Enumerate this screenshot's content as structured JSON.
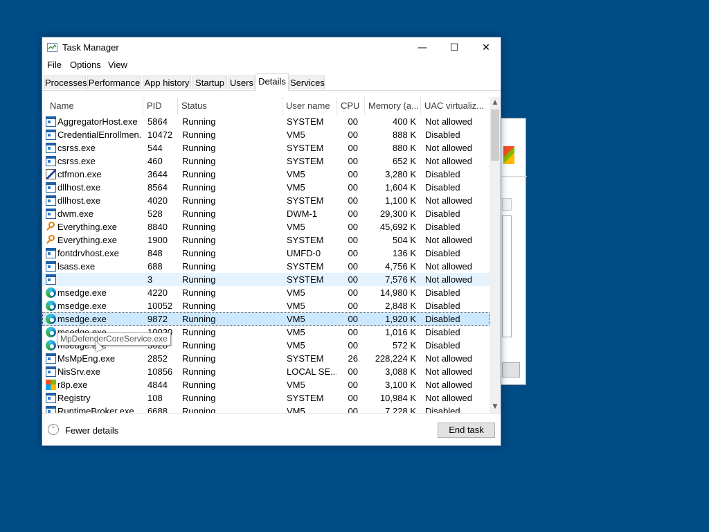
{
  "window": {
    "title": "Task Manager",
    "icon": "task-manager-icon",
    "controls": {
      "minimize": "—",
      "maximize": "☐",
      "close": "✕"
    }
  },
  "menu": [
    "File",
    "Options",
    "View"
  ],
  "tabs": [
    {
      "label": "Processes",
      "active": false
    },
    {
      "label": "Performance",
      "active": false
    },
    {
      "label": "App history",
      "active": false
    },
    {
      "label": "Startup",
      "active": false
    },
    {
      "label": "Users",
      "active": false
    },
    {
      "label": "Details",
      "active": true
    },
    {
      "label": "Services",
      "active": false
    }
  ],
  "columns": [
    "Name",
    "PID",
    "Status",
    "User name",
    "CPU",
    "Memory (a...",
    "UAC virtualiz..."
  ],
  "rows": [
    {
      "icon": "exe",
      "name": "AggregatorHost.exe",
      "pid": "5864",
      "status": "Running",
      "user": "SYSTEM",
      "cpu": "00",
      "mem": "400 K",
      "uac": "Not allowed"
    },
    {
      "icon": "exe",
      "name": "CredentialEnrollmen...",
      "pid": "10472",
      "status": "Running",
      "user": "VM5",
      "cpu": "00",
      "mem": "888 K",
      "uac": "Disabled"
    },
    {
      "icon": "exe",
      "name": "csrss.exe",
      "pid": "544",
      "status": "Running",
      "user": "SYSTEM",
      "cpu": "00",
      "mem": "880 K",
      "uac": "Not allowed"
    },
    {
      "icon": "exe",
      "name": "csrss.exe",
      "pid": "460",
      "status": "Running",
      "user": "SYSTEM",
      "cpu": "00",
      "mem": "652 K",
      "uac": "Not allowed"
    },
    {
      "icon": "pen",
      "name": "ctfmon.exe",
      "pid": "3644",
      "status": "Running",
      "user": "VM5",
      "cpu": "00",
      "mem": "3,280 K",
      "uac": "Disabled"
    },
    {
      "icon": "exe",
      "name": "dllhost.exe",
      "pid": "8564",
      "status": "Running",
      "user": "VM5",
      "cpu": "00",
      "mem": "1,604 K",
      "uac": "Disabled"
    },
    {
      "icon": "exe",
      "name": "dllhost.exe",
      "pid": "4020",
      "status": "Running",
      "user": "SYSTEM",
      "cpu": "00",
      "mem": "1,100 K",
      "uac": "Not allowed"
    },
    {
      "icon": "exe",
      "name": "dwm.exe",
      "pid": "528",
      "status": "Running",
      "user": "DWM-1",
      "cpu": "00",
      "mem": "29,300 K",
      "uac": "Disabled"
    },
    {
      "icon": "search",
      "name": "Everything.exe",
      "pid": "8840",
      "status": "Running",
      "user": "VM5",
      "cpu": "00",
      "mem": "45,692 K",
      "uac": "Disabled"
    },
    {
      "icon": "search",
      "name": "Everything.exe",
      "pid": "1900",
      "status": "Running",
      "user": "SYSTEM",
      "cpu": "00",
      "mem": "504 K",
      "uac": "Not allowed"
    },
    {
      "icon": "exe",
      "name": "fontdrvhost.exe",
      "pid": "848",
      "status": "Running",
      "user": "UMFD-0",
      "cpu": "00",
      "mem": "136 K",
      "uac": "Disabled"
    },
    {
      "icon": "exe",
      "name": "lsass.exe",
      "pid": "688",
      "status": "Running",
      "user": "SYSTEM",
      "cpu": "00",
      "mem": "4,756 K",
      "uac": "Not allowed"
    },
    {
      "icon": "exe",
      "name": "",
      "pid": "3",
      "status": "Running",
      "user": "SYSTEM",
      "cpu": "00",
      "mem": "7,576 K",
      "uac": "Not allowed",
      "state": "hover"
    },
    {
      "icon": "edge",
      "name": "msedge.exe",
      "pid": "4220",
      "status": "Running",
      "user": "VM5",
      "cpu": "00",
      "mem": "14,980 K",
      "uac": "Disabled"
    },
    {
      "icon": "edge",
      "name": "msedge.exe",
      "pid": "10052",
      "status": "Running",
      "user": "VM5",
      "cpu": "00",
      "mem": "2,848 K",
      "uac": "Disabled"
    },
    {
      "icon": "edge",
      "name": "msedge.exe",
      "pid": "9872",
      "status": "Running",
      "user": "VM5",
      "cpu": "00",
      "mem": "1,920 K",
      "uac": "Disabled",
      "state": "selected"
    },
    {
      "icon": "edge",
      "name": "msedge.exe",
      "pid": "10020",
      "status": "Running",
      "user": "VM5",
      "cpu": "00",
      "mem": "1,016 K",
      "uac": "Disabled"
    },
    {
      "icon": "edge",
      "name": "msedge.exe",
      "pid": "3028",
      "status": "Running",
      "user": "VM5",
      "cpu": "00",
      "mem": "572 K",
      "uac": "Disabled"
    },
    {
      "icon": "exe",
      "name": "MsMpEng.exe",
      "pid": "2852",
      "status": "Running",
      "user": "SYSTEM",
      "cpu": "26",
      "mem": "228,224 K",
      "uac": "Not allowed"
    },
    {
      "icon": "exe",
      "name": "NisSrv.exe",
      "pid": "10856",
      "status": "Running",
      "user": "LOCAL SE...",
      "cpu": "00",
      "mem": "3,088 K",
      "uac": "Not allowed"
    },
    {
      "icon": "win",
      "name": "r8p.exe",
      "pid": "4844",
      "status": "Running",
      "user": "VM5",
      "cpu": "00",
      "mem": "3,100 K",
      "uac": "Not allowed"
    },
    {
      "icon": "exe",
      "name": "Registry",
      "pid": "108",
      "status": "Running",
      "user": "SYSTEM",
      "cpu": "00",
      "mem": "10,984 K",
      "uac": "Not allowed"
    },
    {
      "icon": "exe",
      "name": "RuntimeBroker.exe",
      "pid": "6688",
      "status": "Running",
      "user": "VM5",
      "cpu": "00",
      "mem": "7,228 K",
      "uac": "Disabled"
    }
  ],
  "tooltip": "MpDefenderCoreService.exe",
  "footer": {
    "fewer_details": "Fewer details",
    "end_task": "End task"
  },
  "colors": {
    "desktop": "#004c87",
    "selected_row": "#cce8ff",
    "hover_row": "#e5f3ff"
  }
}
